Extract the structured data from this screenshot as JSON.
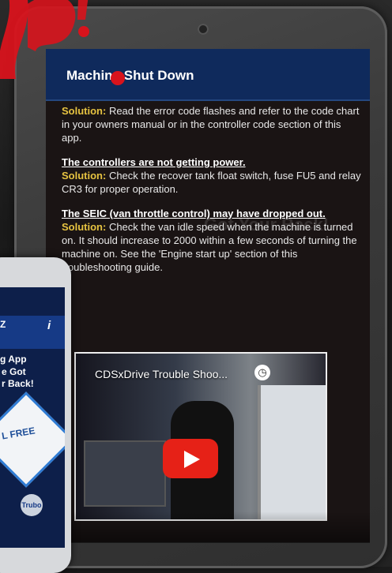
{
  "screen": {
    "header_title": "Machine Shut Down",
    "background_text": "Got Your Back!"
  },
  "content": {
    "para1": {
      "label": "Solution:",
      "text": " Read the error code flashes and refer to the code chart in your owners manual or in the controller code section of this app."
    },
    "section2": {
      "heading": "The controllers are not getting power.",
      "label": "Solution:",
      "text": " Check the recover tank float switch, fuse FU5 and relay CR3 for proper operation."
    },
    "section3": {
      "heading": "The SEIC (van throttle control) may have dropped out.",
      "label": "Solution:",
      "text": " Check the van idle speed when the machine is turned on. It should increase to 2000 within a few seconds of turning the machine on. See the 'Engine start up' section of this troubleshooting guide."
    }
  },
  "video": {
    "title": "CDSxDrive Trouble Shoo...",
    "clock_icon": "clock-icon",
    "play_icon": "play-icon"
  },
  "phone": {
    "header_title": "Z",
    "info_icon": "i",
    "app_label": "g App",
    "slogan": "e Got\nr Back!",
    "badge": "L FREE",
    "logo": "Trubo"
  },
  "colors": {
    "header": "#0f2a5c",
    "solution": "#e6c341",
    "play": "#e62117",
    "splash": "#d8131c"
  }
}
